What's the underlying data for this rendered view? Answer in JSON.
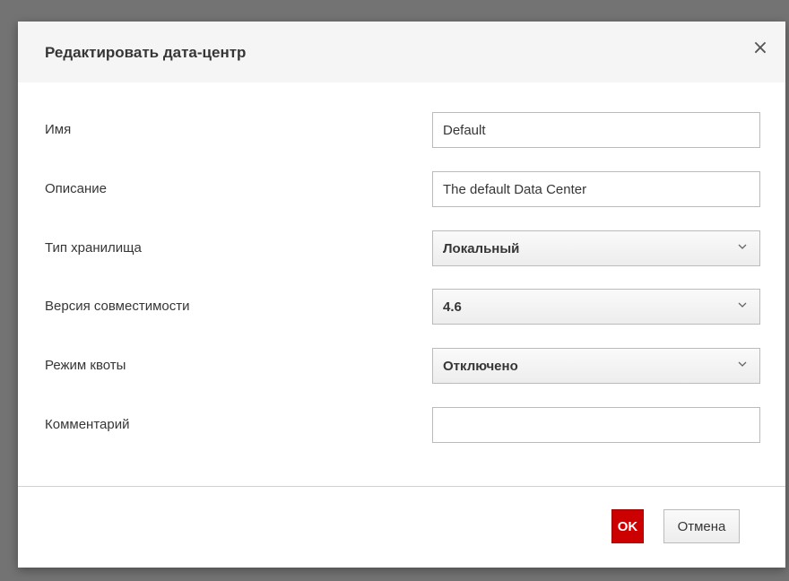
{
  "dialog": {
    "title": "Редактировать дата-центр",
    "close_symbol": "×"
  },
  "fields": {
    "name": {
      "label": "Имя",
      "value": "Default"
    },
    "description": {
      "label": "Описание",
      "value": "The default Data Center"
    },
    "storage_type": {
      "label": "Тип хранилища",
      "value": "Локальный"
    },
    "compat_version": {
      "label": "Версия совместимости",
      "value": "4.6"
    },
    "quota_mode": {
      "label": "Режим квоты",
      "value": "Отключено"
    },
    "comment": {
      "label": "Комментарий",
      "value": ""
    }
  },
  "footer": {
    "ok_label": "OK",
    "cancel_label": "Отмена"
  },
  "colors": {
    "primary_button": "#cc0000",
    "header_bg": "#f5f5f5",
    "backdrop": "#737373"
  },
  "icons": {
    "close": "close-icon",
    "dropdown": "chevron-down-icon"
  }
}
